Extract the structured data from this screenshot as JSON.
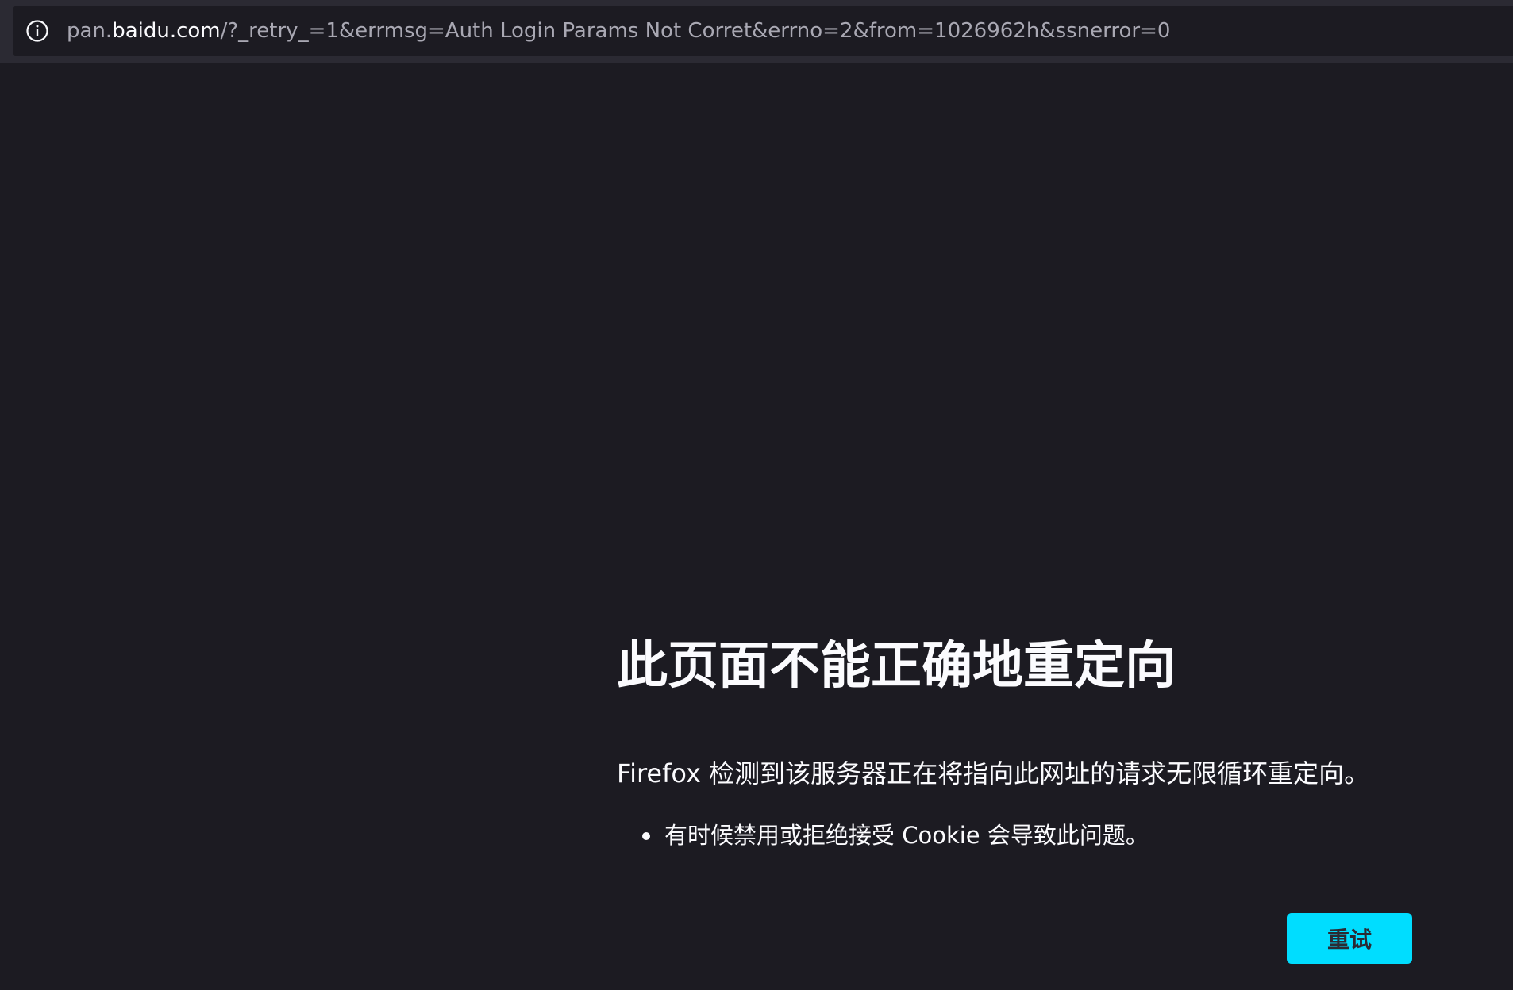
{
  "urlbar": {
    "info_icon": "info-icon",
    "url_prefix": "pan.",
    "url_host": "baidu.com",
    "url_path": "/?_retry_=1&errmsg=Auth Login Params Not Corret&errno=2&from=1026962h&ssnerror=0"
  },
  "error": {
    "title": "此页面不能正确地重定向",
    "description": "Firefox 检测到该服务器正在将指向此网址的请求无限循环重定向。",
    "hints": [
      "有时候禁用或拒绝接受 Cookie 会导致此问题。"
    ],
    "retry_label": "重试"
  },
  "colors": {
    "background": "#1c1b22",
    "toolbar": "#2b2a33",
    "text": "#fbfbfe",
    "url_dim": "#a9a8b3",
    "accent_button": "#00ddff"
  }
}
